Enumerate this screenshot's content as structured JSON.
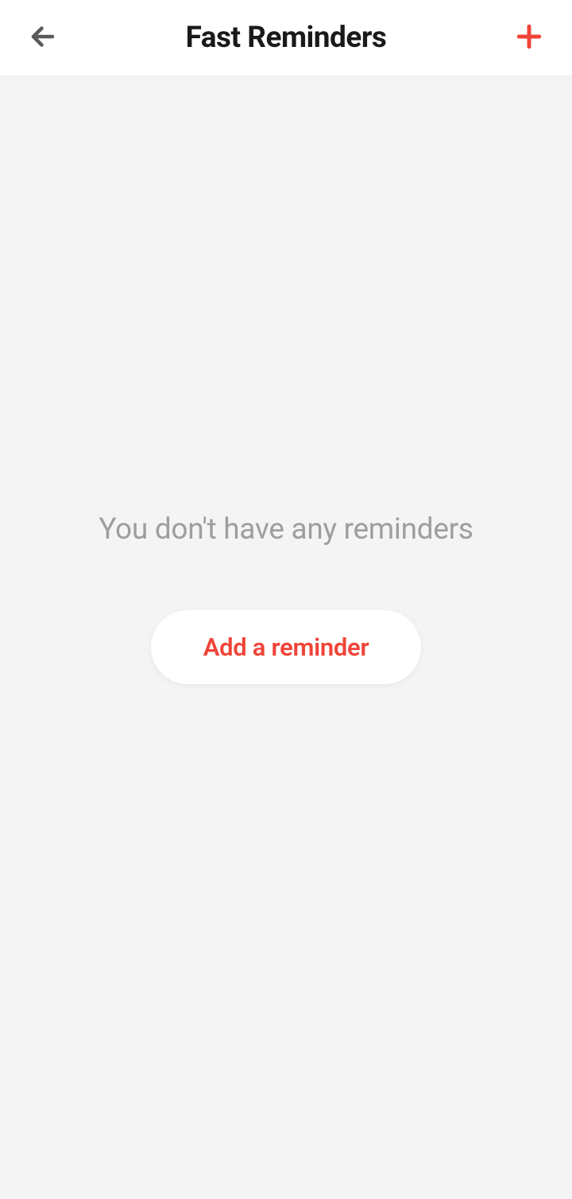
{
  "header": {
    "title": "Fast Reminders"
  },
  "emptyState": {
    "message": "You don't have any reminders",
    "buttonLabel": "Add a reminder"
  }
}
